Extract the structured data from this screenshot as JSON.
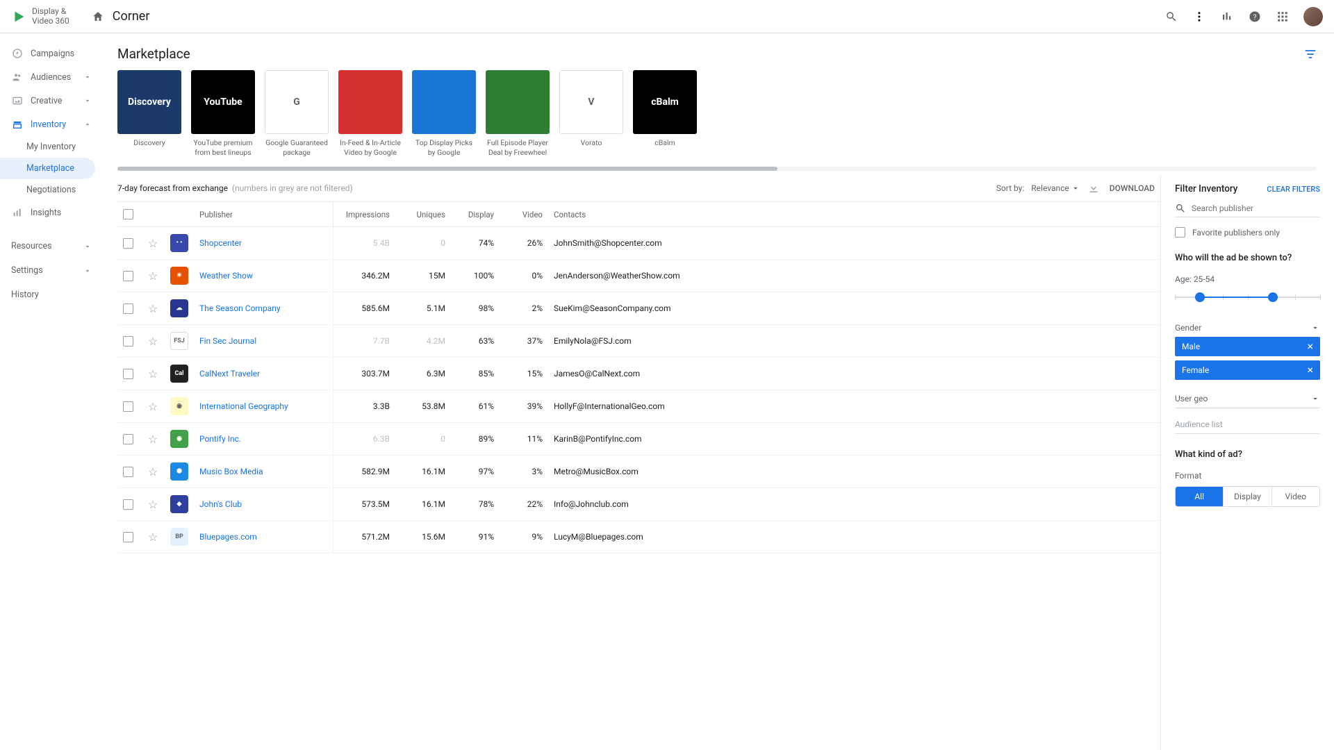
{
  "app": {
    "name_line1": "Display &",
    "name_line2": "Video 360",
    "breadcrumb": "Corner"
  },
  "sidebar": {
    "items": [
      {
        "label": "Campaigns"
      },
      {
        "label": "Audiences"
      },
      {
        "label": "Creative"
      },
      {
        "label": "Inventory"
      }
    ],
    "inventory_sub": [
      {
        "label": "My Inventory"
      },
      {
        "label": "Marketplace"
      },
      {
        "label": "Negotiations"
      }
    ],
    "insights": "Insights",
    "resources": "Resources",
    "settings": "Settings",
    "history": "History"
  },
  "page": {
    "title": "Marketplace"
  },
  "tiles": [
    {
      "label": "Discovery",
      "bg": "#1b3a6b",
      "text": "Discovery"
    },
    {
      "label": "YouTube premium from best lineups",
      "bg": "#000000",
      "text": "YouTube"
    },
    {
      "label": "Google Guaranteed package",
      "bg": "#ffffff",
      "text": "G"
    },
    {
      "label": "In-Feed & In-Article Video by Google",
      "bg": "#d32f2f",
      "text": ""
    },
    {
      "label": "Top Display Picks by Google",
      "bg": "#1976d2",
      "text": ""
    },
    {
      "label": "Full Episode Player Deal by Freewheel",
      "bg": "#2e7d32",
      "text": ""
    },
    {
      "label": "Vorato",
      "bg": "#ffffff",
      "text": "V"
    },
    {
      "label": "cBalm",
      "bg": "#000000",
      "text": "cBalm"
    }
  ],
  "forecast": {
    "title": "7-day forecast from exchange",
    "subtitle": "(numbers in grey are not filtered)",
    "sort_label": "Sort by:",
    "sort_value": "Relevance",
    "download": "DOWNLOAD"
  },
  "table": {
    "headers": {
      "publisher": "Publisher",
      "impressions": "Impressions",
      "uniques": "Uniques",
      "display": "Display",
      "video": "Video",
      "contacts": "Contacts"
    },
    "rows": [
      {
        "name": "Shopcenter",
        "logo_bg": "#3949ab",
        "logo_txt": "• •",
        "imp": "5.4B",
        "imp_grey": true,
        "uniq": "0",
        "uniq_grey": true,
        "disp": "74%",
        "vid": "26%",
        "contact": "JohnSmith@Shopcenter.com"
      },
      {
        "name": "Weather Show",
        "logo_bg": "#e65100",
        "logo_txt": "☀",
        "imp": "346.2M",
        "imp_grey": false,
        "uniq": "15M",
        "uniq_grey": false,
        "disp": "100%",
        "vid": "0%",
        "contact": "JenAnderson@WeatherShow.com"
      },
      {
        "name": "The Season Company",
        "logo_bg": "#283593",
        "logo_txt": "☁",
        "imp": "585.6M",
        "imp_grey": false,
        "uniq": "5.1M",
        "uniq_grey": false,
        "disp": "98%",
        "vid": "2%",
        "contact": "SueKim@SeasonCompany.com"
      },
      {
        "name": "Fin Sec Journal",
        "logo_bg": "#ffffff",
        "logo_txt": "FSJ",
        "imp": "7.7B",
        "imp_grey": true,
        "uniq": "4.2M",
        "uniq_grey": true,
        "disp": "63%",
        "vid": "37%",
        "contact": "EmilyNola@FSJ.com"
      },
      {
        "name": "CalNext Traveler",
        "logo_bg": "#212121",
        "logo_txt": "Cal",
        "imp": "303.7M",
        "imp_grey": false,
        "uniq": "6.3M",
        "uniq_grey": false,
        "disp": "85%",
        "vid": "15%",
        "contact": "JamesO@CalNext.com"
      },
      {
        "name": "International Geography",
        "logo_bg": "#fff9c4",
        "logo_txt": "◉",
        "imp": "3.3B",
        "imp_grey": false,
        "uniq": "53.8M",
        "uniq_grey": false,
        "disp": "61%",
        "vid": "39%",
        "contact": "HollyF@InternationalGeo.com"
      },
      {
        "name": "Pontify Inc.",
        "logo_bg": "#43a047",
        "logo_txt": "◉",
        "imp": "6.3B",
        "imp_grey": true,
        "uniq": "0",
        "uniq_grey": true,
        "disp": "89%",
        "vid": "11%",
        "contact": "KarinB@PontifyInc.com"
      },
      {
        "name": "Music Box Media",
        "logo_bg": "#1e88e5",
        "logo_txt": "⬢",
        "imp": "582.9M",
        "imp_grey": false,
        "uniq": "16.1M",
        "uniq_grey": false,
        "disp": "97%",
        "vid": "3%",
        "contact": "Metro@MusicBox.com"
      },
      {
        "name": "John's Club",
        "logo_bg": "#303f9f",
        "logo_txt": "◆",
        "imp": "573.5M",
        "imp_grey": false,
        "uniq": "16.1M",
        "uniq_grey": false,
        "disp": "78%",
        "vid": "22%",
        "contact": "Info@Johnclub.com"
      },
      {
        "name": "Bluepages.com",
        "logo_bg": "#e3f2fd",
        "logo_txt": "BP",
        "imp": "571.2M",
        "imp_grey": false,
        "uniq": "15.6M",
        "uniq_grey": false,
        "disp": "91%",
        "vid": "9%",
        "contact": "LucyM@Bluepages.com"
      }
    ]
  },
  "filter": {
    "title": "Filter Inventory",
    "clear": "CLEAR FILTERS",
    "search_placeholder": "Search publisher",
    "fav_only": "Favorite publishers only",
    "who_section": "Who will the ad be shown to?",
    "age_label": "Age: 25-54",
    "gender_label": "Gender",
    "gender_chips": [
      "Male",
      "Female"
    ],
    "usergeo_label": "User geo",
    "audience_label": "Audience list",
    "kind_section": "What kind of ad?",
    "format_label": "Format",
    "format_options": [
      "All",
      "Display",
      "Video"
    ]
  }
}
